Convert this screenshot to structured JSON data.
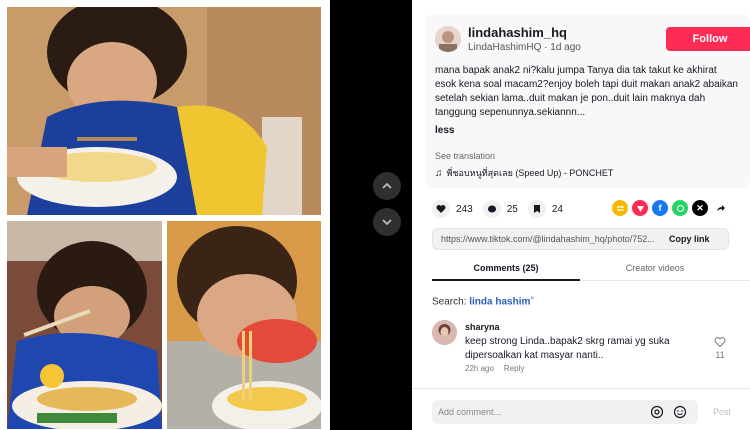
{
  "post": {
    "username": "lindahashim_hq",
    "handle": "LindaHashimHQ",
    "time": "· 1d ago",
    "follow_label": "Follow",
    "caption": "mana bapak anak2 ni?kalu jumpa Tanya dia tak takut ke akhirat esok kena soal macam2?enjoy boleh tapi duit makan anak2 abaikan setelah sekian lama..duit makan je pon..duit lain maknya dah tanggung sepenunnya.sekiannn...",
    "less_label": "less",
    "see_translation": "See translation",
    "music": "พี่ชอบหนูที่สุดเลย (Speed Up) - PONCHET"
  },
  "stats": {
    "likes": "243",
    "comments": "25",
    "saves": "24"
  },
  "share": {
    "url": "https://www.tiktok.com/@lindahashim_hq/photo/752...",
    "copy_label": "Copy link",
    "icons": [
      "repost-icon",
      "pin-icon",
      "facebook-icon",
      "whatsapp-icon",
      "x-icon",
      "share-arrow-icon"
    ]
  },
  "tabs": {
    "comments": "Comments (25)",
    "creator": "Creator videos"
  },
  "search": {
    "prefix": "Search: ",
    "query": "linda hashim"
  },
  "comments": [
    {
      "name": "sharyna",
      "text": "keep strong Linda..bapak2 skrg ramai yg suka dipersoalkan kat masyar nanti..",
      "time": "22h ago",
      "reply": "Reply",
      "likes": "11"
    }
  ],
  "composer": {
    "placeholder": "Add comment...",
    "post_label": "Post"
  },
  "colors": {
    "follow": "#fe2c55",
    "search_link": "#2b5db9"
  }
}
